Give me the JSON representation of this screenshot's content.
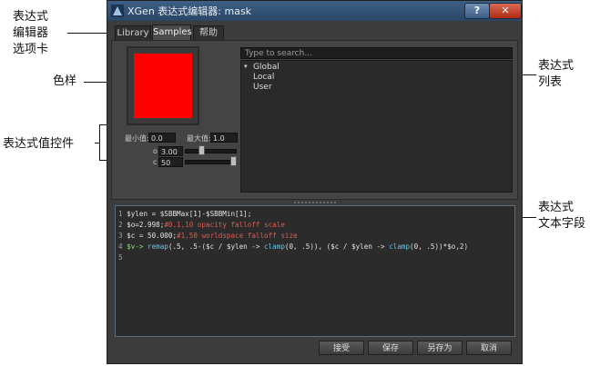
{
  "annotations": {
    "tabs": [
      "表达式",
      "编辑器",
      "选项卡"
    ],
    "swatch": "色样",
    "value_controls": "表达式值控件",
    "list": [
      "表达式",
      "列表"
    ],
    "text_field": [
      "表达式",
      "文本字段"
    ]
  },
  "window": {
    "title": "XGen 表达式编辑器: mask",
    "help_label": "?",
    "close_label": "✕"
  },
  "tabs": [
    {
      "label": "Library",
      "active": false
    },
    {
      "label": "Samples",
      "active": true
    },
    {
      "label": "帮助",
      "active": false
    }
  ],
  "swatch_color": "#ff0000",
  "controls": {
    "min_label": "最小值:",
    "min_value": "0.0",
    "max_label": "最大值:",
    "max_value": "1.0",
    "o_label": "o",
    "o_value": "3.00",
    "c_label": "c",
    "c_value": "50"
  },
  "search": {
    "placeholder": "Type to search..."
  },
  "expression_list": [
    {
      "label": "Global",
      "expanded": true
    },
    {
      "label": "Local"
    },
    {
      "label": "User"
    }
  ],
  "code_lines": [
    {
      "n": "1",
      "segments": [
        {
          "t": "$ylen = $SBBMax[1]-$SBBMin[1];",
          "c": "white"
        }
      ]
    },
    {
      "n": "2",
      "segments": [
        {
          "t": "$o=2.998;",
          "c": "white"
        },
        {
          "t": "#0.1,10 opacity falloff scale",
          "c": "red"
        }
      ]
    },
    {
      "n": "3",
      "segments": [
        {
          "t": "$c = 50.000;",
          "c": "white"
        },
        {
          "t": "#1,50 worldspace falloff size",
          "c": "red"
        }
      ]
    },
    {
      "n": "4",
      "segments": [
        {
          "t": "$v-> ",
          "c": "green"
        },
        {
          "t": "remap",
          "c": "cyan"
        },
        {
          "t": "(.5, .5-($c / $ylen -> ",
          "c": "white"
        },
        {
          "t": "clamp",
          "c": "cyan"
        },
        {
          "t": "(0, .5)), ($c / $ylen -> ",
          "c": "white"
        },
        {
          "t": "clamp",
          "c": "cyan"
        },
        {
          "t": "(0, .5))*$o,2)",
          "c": "white"
        }
      ]
    },
    {
      "n": "5",
      "segments": []
    }
  ],
  "buttons": {
    "apply": "接受",
    "save": "保存",
    "save_as": "另存为",
    "cancel": "取消"
  }
}
